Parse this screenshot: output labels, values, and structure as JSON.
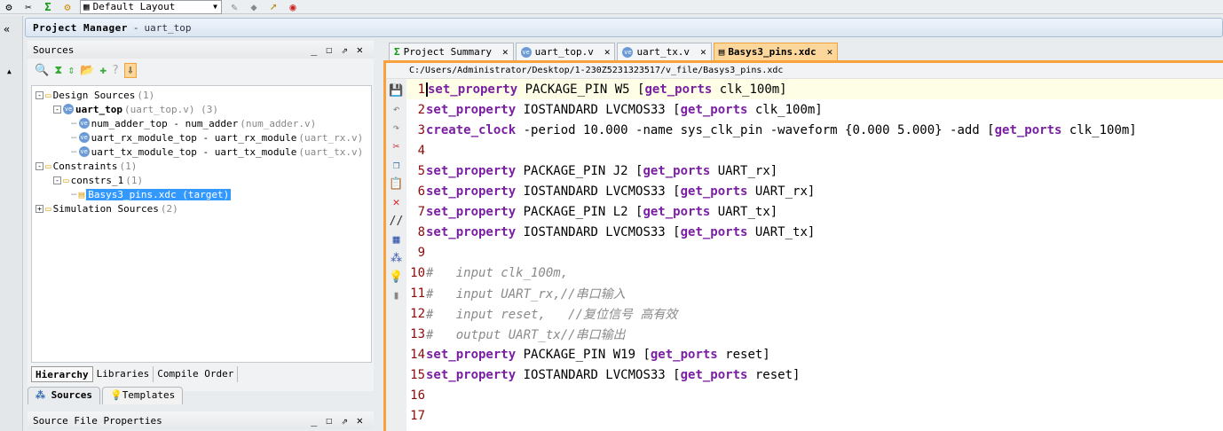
{
  "toolbar": {
    "layout": "Default Layout"
  },
  "project_manager": {
    "title": "Project Manager",
    "subtitle": "uart_top"
  },
  "sources": {
    "title": "Sources",
    "tree": [
      {
        "level": 0,
        "expand": "−",
        "icon": "folder",
        "label": "Design Sources",
        "note": "(1)"
      },
      {
        "level": 1,
        "expand": "−",
        "icon": "verilog",
        "label": "uart_top",
        "note": "(uart_top.v) (3)",
        "bold": true
      },
      {
        "level": 2,
        "icon": "verilog",
        "label": "num_adder_top - num_adder",
        "note": "(num_adder.v)"
      },
      {
        "level": 2,
        "icon": "verilog",
        "label": "uart_rx_module_top - uart_rx_module",
        "note": "(uart_rx.v)"
      },
      {
        "level": 2,
        "icon": "verilog",
        "label": "uart_tx_module_top - uart_tx_module",
        "note": "(uart_tx.v)"
      },
      {
        "level": 0,
        "expand": "−",
        "icon": "folder",
        "label": "Constraints",
        "note": "(1)"
      },
      {
        "level": 1,
        "expand": "−",
        "icon": "folder",
        "label": "constrs_1",
        "note": "(1)"
      },
      {
        "level": 2,
        "icon": "xdc",
        "label": "Basys3_pins.xdc (target)",
        "note": "",
        "selected": true
      },
      {
        "level": 0,
        "expand": "+",
        "icon": "folder",
        "label": "Simulation Sources",
        "note": "(2)"
      }
    ],
    "subtabs": [
      "Hierarchy",
      "Libraries",
      "Compile Order"
    ],
    "bottom_tabs": [
      "Sources",
      "Templates"
    ]
  },
  "source_file_properties": {
    "title": "Source File Properties"
  },
  "editor": {
    "tabs": [
      {
        "label": "Project Summary",
        "icon": "Σ"
      },
      {
        "label": "uart_top.v",
        "icon": "ve"
      },
      {
        "label": "uart_tx.v",
        "icon": "ve"
      },
      {
        "label": "Basys3_pins.xdc",
        "icon": "▤",
        "active": true
      }
    ],
    "path": "C:/Users/Administrator/Desktop/1-230Z5231323517/v_file/Basys3_pins.xdc",
    "lines": [
      [
        [
          "kw",
          "set_property"
        ],
        [
          "t",
          " PACKAGE_PIN W5 ["
        ],
        [
          "kw",
          "get_ports"
        ],
        [
          "t",
          " clk_100m]"
        ]
      ],
      [
        [
          "kw",
          "set_property"
        ],
        [
          "t",
          " IOSTANDARD LVCMOS33 ["
        ],
        [
          "kw",
          "get_ports"
        ],
        [
          "t",
          " clk_100m]"
        ]
      ],
      [
        [
          "kw",
          "create_clock"
        ],
        [
          "t",
          " -period 10.000 -name sys_clk_pin -waveform {0.000 5.000} -add ["
        ],
        [
          "kw",
          "get_ports"
        ],
        [
          "t",
          " clk_100m]"
        ]
      ],
      [],
      [
        [
          "kw",
          "set_property"
        ],
        [
          "t",
          " PACKAGE_PIN J2 ["
        ],
        [
          "kw",
          "get_ports"
        ],
        [
          "t",
          " UART_rx]"
        ]
      ],
      [
        [
          "kw",
          "set_property"
        ],
        [
          "t",
          " IOSTANDARD LVCMOS33 ["
        ],
        [
          "kw",
          "get_ports"
        ],
        [
          "t",
          " UART_rx]"
        ]
      ],
      [
        [
          "kw",
          "set_property"
        ],
        [
          "t",
          " PACKAGE_PIN L2 ["
        ],
        [
          "kw",
          "get_ports"
        ],
        [
          "t",
          " UART_tx]"
        ]
      ],
      [
        [
          "kw",
          "set_property"
        ],
        [
          "t",
          " IOSTANDARD LVCMOS33 ["
        ],
        [
          "kw",
          "get_ports"
        ],
        [
          "t",
          " UART_tx]"
        ]
      ],
      [],
      [
        [
          "cm",
          "#   input clk_100m,"
        ]
      ],
      [
        [
          "cm",
          "#   input UART_rx,//串口输入"
        ]
      ],
      [
        [
          "cm",
          "#   input reset,   //复位信号 高有效"
        ]
      ],
      [
        [
          "cm",
          "#   output UART_tx//串口输出"
        ]
      ],
      [
        [
          "kw",
          "set_property"
        ],
        [
          "t",
          " PACKAGE_PIN W19 ["
        ],
        [
          "kw",
          "get_ports"
        ],
        [
          "t",
          " reset]"
        ]
      ],
      [
        [
          "kw",
          "set_property"
        ],
        [
          "t",
          " IOSTANDARD LVCMOS33 ["
        ],
        [
          "kw",
          "get_ports"
        ],
        [
          "t",
          " reset]"
        ]
      ],
      [],
      []
    ]
  }
}
